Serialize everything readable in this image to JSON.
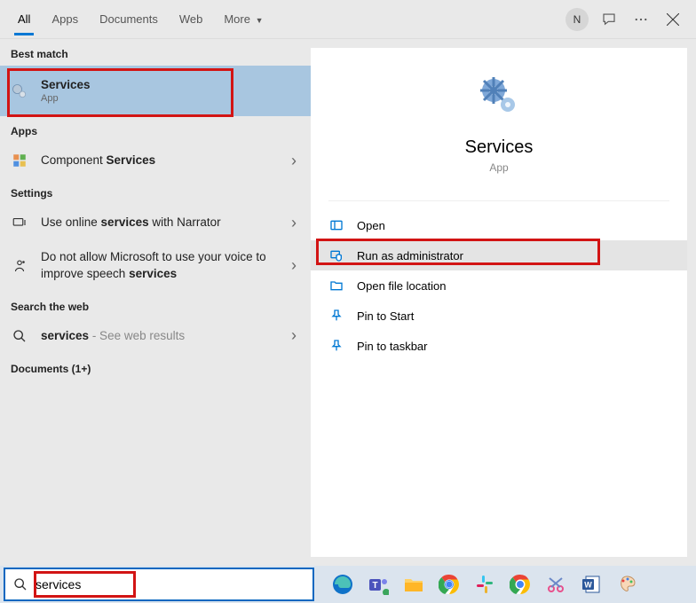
{
  "tabs": {
    "all": "All",
    "apps": "Apps",
    "documents": "Documents",
    "web": "Web",
    "more": "More"
  },
  "avatar_letter": "N",
  "sections": {
    "best_match": "Best match",
    "apps": "Apps",
    "settings": "Settings",
    "web": "Search the web",
    "documents": "Documents (1+)"
  },
  "best_match": {
    "title": "Services",
    "sub": "App"
  },
  "apps_results": {
    "component_prefix": "Component ",
    "component_bold": "Services"
  },
  "settings_results": {
    "s1_a": "Use online ",
    "s1_b": "services",
    "s1_c": " with Narrator",
    "s2_a": "Do not allow Microsoft to use your voice to improve speech ",
    "s2_b": "services"
  },
  "web_results": {
    "term_bold": "services",
    "suffix": " - See web results"
  },
  "detail": {
    "title": "Services",
    "sub": "App",
    "actions": {
      "open": "Open",
      "run_admin": "Run as administrator",
      "open_location": "Open file location",
      "pin_start": "Pin to Start",
      "pin_taskbar": "Pin to taskbar"
    }
  },
  "search": {
    "value": "services"
  }
}
